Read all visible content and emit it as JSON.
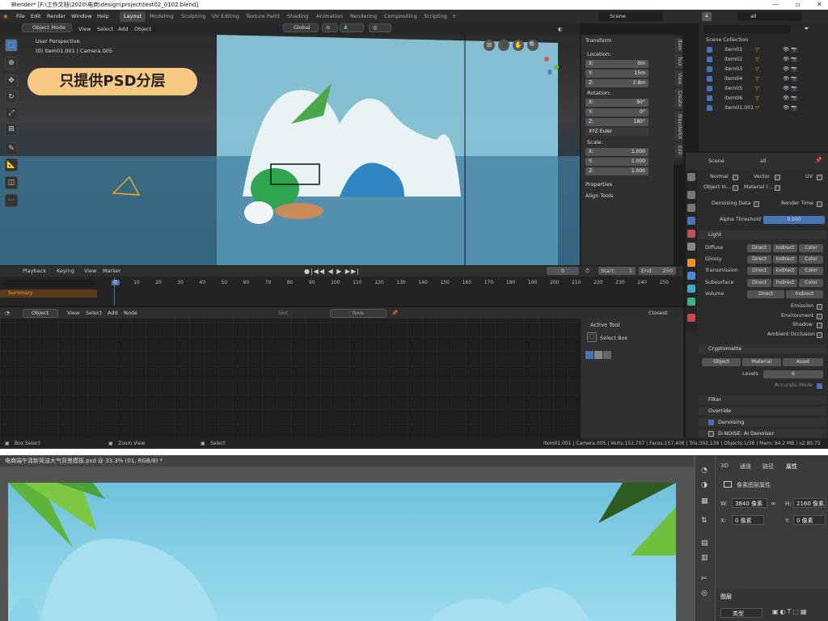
{
  "blender": {
    "title": "Blender* [F:\\工作文档\\2020\\电商\\design\\project\\test02_0102.blend]",
    "menu": [
      "File",
      "Edit",
      "Render",
      "Window",
      "Help"
    ],
    "workspaces": [
      "Layout",
      "Modeling",
      "Sculpting",
      "UV Editing",
      "Texture Paint",
      "Shading",
      "Animation",
      "Rendering",
      "Compositing",
      "Scripting"
    ],
    "scene_label": "Scene",
    "view_layer": "all",
    "layer_count": "4",
    "viewport": {
      "mode": "Object Mode",
      "menu": [
        "View",
        "Select",
        "Add",
        "Object"
      ],
      "orientation": "Global",
      "overlay_line1": "User Perspective",
      "overlay_line2": "(0) item01.001 | Camera.005"
    },
    "banner": "只提供PSD分层",
    "npanel": {
      "section": "Transform",
      "location_label": "Location:",
      "location": [
        {
          "k": "X:",
          "v": "0m"
        },
        {
          "k": "Y:",
          "v": "15m"
        },
        {
          "k": "Z:",
          "v": "2.8m"
        }
      ],
      "rotation_label": "Rotation:",
      "rotation": [
        {
          "k": "X:",
          "v": "90°"
        },
        {
          "k": "Y:",
          "v": "0°"
        },
        {
          "k": "Z:",
          "v": "180°"
        }
      ],
      "euler": "XYZ Euler",
      "scale_label": "Scale:",
      "scale": [
        {
          "k": "X:",
          "v": "1.000"
        },
        {
          "k": "Y:",
          "v": "1.000"
        },
        {
          "k": "Z:",
          "v": "1.000"
        }
      ],
      "properties": "Properties",
      "align_tools": "Align Tools",
      "tabs": [
        "Item",
        "Tool",
        "View",
        "Create",
        "Blenderkit",
        "Edit"
      ]
    },
    "outliner": {
      "collection": "Scene Collection",
      "items": [
        "item01",
        "item02",
        "item03",
        "item04",
        "item05",
        "item06",
        "item01.001"
      ]
    },
    "props": {
      "scene": "Scene",
      "layer": "all",
      "row1": [
        "Normal",
        "Vector",
        "UV"
      ],
      "row2": [
        "Object In...",
        "Material I..."
      ],
      "denoising_data": "Denoising Data",
      "render_time": "Render Time",
      "alpha_label": "Alpha Threshold",
      "alpha_value": "0.500",
      "light": "Light",
      "light_rows": [
        {
          "name": "Diffuse",
          "b": [
            "Direct",
            "Indirect",
            "Color"
          ]
        },
        {
          "name": "Glossy",
          "b": [
            "Direct",
            "Indirect",
            "Color"
          ]
        },
        {
          "name": "Transmission",
          "b": [
            "Direct",
            "Indirect",
            "Color"
          ]
        },
        {
          "name": "Subsurface",
          "b": [
            "Direct",
            "Indirect",
            "Color"
          ]
        }
      ],
      "volume": "Volume",
      "volume_b": [
        "Direct",
        "Indirect"
      ],
      "checks": [
        "Emission",
        "Environment",
        "Shadow",
        "Ambient Occlusion"
      ],
      "cryptomatte": "Cryptomatte",
      "crypto_b": [
        "Object",
        "Material",
        "Asset"
      ],
      "levels_label": "Levels",
      "levels_value": "6",
      "accurate": "Accurate Mode",
      "filter": "Filter",
      "override": "Override",
      "denoising": "Denoising",
      "dnoise": "D-NOISE: AI Denoiser"
    },
    "timeline": {
      "menu": [
        "Playback",
        "Keying",
        "View",
        "Marker"
      ],
      "summary": "Summary",
      "current": "0",
      "start_label": "Start:",
      "start": "1",
      "end_label": "End:",
      "end": "250",
      "ticks": [
        "0",
        "10",
        "20",
        "30",
        "40",
        "50",
        "60",
        "70",
        "80",
        "90",
        "100",
        "110",
        "120",
        "130",
        "140",
        "150",
        "160",
        "170",
        "180",
        "190",
        "200",
        "210",
        "220",
        "230",
        "240",
        "250"
      ]
    },
    "node_editor": {
      "mode": "Object",
      "menu": [
        "View",
        "Select",
        "Add",
        "Node"
      ],
      "slot": "Slot",
      "new": "New",
      "closest": "Closest"
    },
    "active_tool": {
      "title": "Active Tool",
      "tool": "Select Box"
    },
    "status": {
      "left": "Box Select",
      "mid": "Zoom View",
      "right": "Select",
      "stats": "item01.001 | Camera.005 | Verts:153,707 | Faces:157,406 | Tris:302,136 | Objects:1/38 | Mem: 94.2 MB | v2.80.75"
    }
  },
  "photoshop": {
    "tab": "电商端午清新简洁大气背景模板.psd @ 33.3% (01, RGB/8) *",
    "panel_tabs": [
      "3D",
      "通道",
      "路径",
      "属性"
    ],
    "layer_props": "像素图层属性",
    "w_label": "W:",
    "w": "3840 像素",
    "h_label": "H:",
    "h": "2160 像素",
    "x_label": "X:",
    "x": "0 像素",
    "y_label": "Y:",
    "y": "0 像素",
    "layers_tab": "图层",
    "kind": "类型"
  },
  "colors": {
    "accent": "#4772b3",
    "banner": "#f7c983",
    "water": "#6fc1dc"
  }
}
